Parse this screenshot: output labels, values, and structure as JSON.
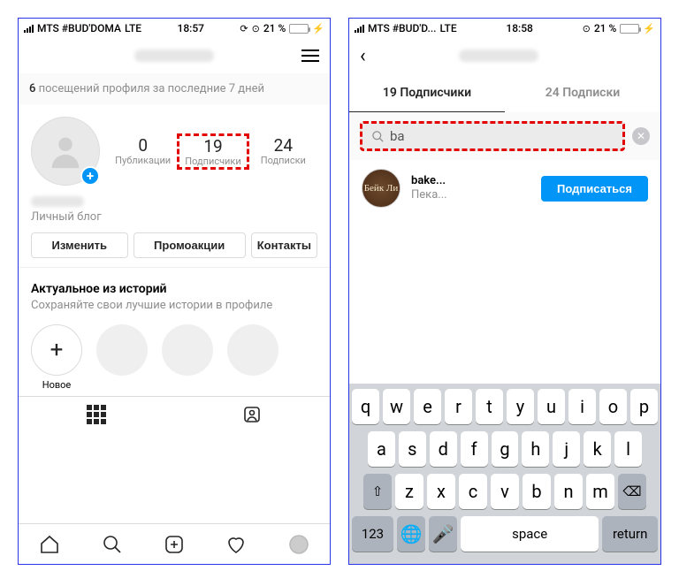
{
  "left": {
    "status": {
      "carrier": "MTS #BUD'DOMA",
      "network": "LTE",
      "time": "18:57",
      "battery_pct": "21 %"
    },
    "visits": {
      "count": "6",
      "text": "посещений профиля за последние 7 дней"
    },
    "stats": {
      "posts": {
        "num": "0",
        "label": "Публикации"
      },
      "followers": {
        "num": "19",
        "label": "Подписчики"
      },
      "following": {
        "num": "24",
        "label": "Подписки"
      }
    },
    "bio": "Личный блог",
    "buttons": {
      "edit": "Изменить",
      "promo": "Промоакции",
      "contacts": "Контакты"
    },
    "highlights": {
      "title": "Актуальное из историй",
      "subtitle": "Сохраняйте свои лучшие истории в профиле",
      "new_label": "Новое",
      "plus": "+"
    }
  },
  "right": {
    "status": {
      "carrier": "MTS #BUD'D...",
      "network": "LTE",
      "time": "18:58",
      "battery_pct": "21 %"
    },
    "tabs": {
      "followers": "19 Подписчики",
      "following": "24 Подписки"
    },
    "search": {
      "query": "ba"
    },
    "result": {
      "name": "bake...",
      "sub": "Пека...",
      "avatar_text": "Бейк Ли",
      "action": "Подписаться"
    },
    "keyboard": {
      "row1": [
        "q",
        "w",
        "e",
        "r",
        "t",
        "y",
        "u",
        "i",
        "o",
        "p"
      ],
      "row2": [
        "a",
        "s",
        "d",
        "f",
        "g",
        "h",
        "j",
        "k",
        "l"
      ],
      "row3": [
        "z",
        "x",
        "c",
        "v",
        "b",
        "n",
        "m"
      ],
      "shift": "⇧",
      "backspace": "⌫",
      "numbers": "123",
      "globe": "🌐",
      "mic": "🎤",
      "space": "space",
      "return": "return"
    }
  }
}
